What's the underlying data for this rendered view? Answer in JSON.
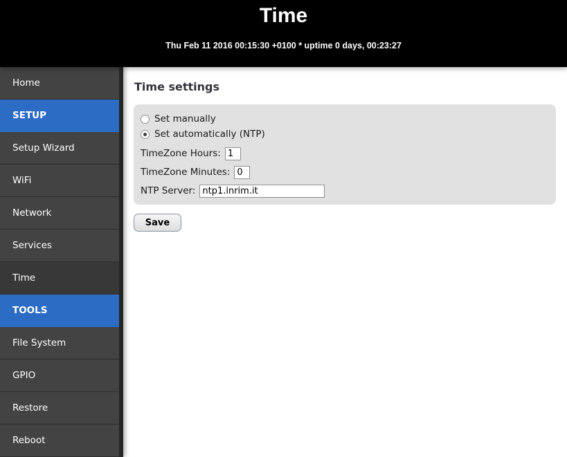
{
  "header": {
    "title": "Time",
    "status_line": "Thu Feb 11 2016 00:15:30 +0100 * uptime 0 days, 00:23:27"
  },
  "sidebar": {
    "items": [
      {
        "label": "Home",
        "type": "link",
        "selected": false
      },
      {
        "label": "SETUP",
        "type": "section",
        "selected": false
      },
      {
        "label": "Setup Wizard",
        "type": "link",
        "selected": false
      },
      {
        "label": "WiFi",
        "type": "link",
        "selected": false
      },
      {
        "label": "Network",
        "type": "link",
        "selected": false
      },
      {
        "label": "Services",
        "type": "link",
        "selected": false
      },
      {
        "label": "Time",
        "type": "link",
        "selected": true
      },
      {
        "label": "TOOLS",
        "type": "section",
        "selected": false
      },
      {
        "label": "File System",
        "type": "link",
        "selected": false
      },
      {
        "label": "GPIO",
        "type": "link",
        "selected": false
      },
      {
        "label": "Restore",
        "type": "link",
        "selected": false
      },
      {
        "label": "Reboot",
        "type": "link",
        "selected": false
      }
    ]
  },
  "main": {
    "heading": "Time settings",
    "form": {
      "radio_manual": {
        "label": "Set manually",
        "checked": false
      },
      "radio_ntp": {
        "label": "Set automatically (NTP)",
        "checked": true
      },
      "tz_hours": {
        "label": "TimeZone Hours:",
        "value": "1"
      },
      "tz_minutes": {
        "label": "TimeZone Minutes:",
        "value": "0"
      },
      "ntp_server": {
        "label": "NTP Server:",
        "value": "ntp1.inrim.it"
      }
    },
    "save_label": "Save"
  },
  "colors": {
    "header_bg": "#000000",
    "accent_blue": "#2d6cc4",
    "sidebar_item_bg": "#434343",
    "sidebar_selected_bg": "#383838",
    "sidebar_edge": "#262626",
    "panel_bg": "#e1e1e1"
  }
}
